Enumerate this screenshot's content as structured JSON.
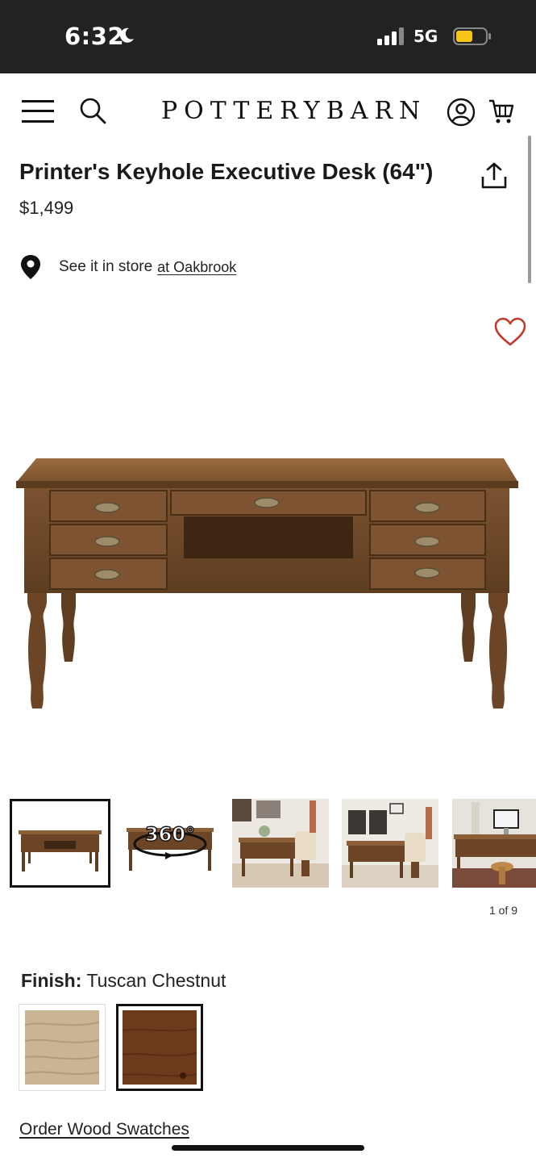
{
  "status_bar": {
    "time": "6:32",
    "network": "5G",
    "icons": [
      "moon-icon",
      "signal-icon",
      "battery-icon"
    ]
  },
  "header": {
    "logo": "POTTERYBARN",
    "icons": [
      "hamburger-icon",
      "search-icon",
      "account-icon",
      "cart-icon"
    ]
  },
  "product": {
    "title": "Printer's Keyhole Executive Desk (64\")",
    "price": "$1,499"
  },
  "store": {
    "text": "See it in store",
    "link": "at Oakbrook"
  },
  "gallery": {
    "counter": "1 of 9",
    "badge_360": "360°",
    "thumbnails": [
      "desk-front",
      "desk-360",
      "desk-room-1",
      "desk-room-2",
      "desk-room-3"
    ]
  },
  "finish": {
    "label": "Finish:",
    "value": "Tuscan Chestnut",
    "swatches": [
      {
        "name": "light-wood",
        "color": "#c9b593",
        "selected": false
      },
      {
        "name": "tuscan-chestnut",
        "color": "#6e3a1c",
        "selected": true
      }
    ]
  },
  "order_swatches_link": "Order Wood Swatches",
  "colors": {
    "status_bar": "#222222",
    "heart": "#c0392b",
    "wood": "#7a5230",
    "wood_dark": "#4e3219",
    "brass": "#9d8b6a"
  }
}
